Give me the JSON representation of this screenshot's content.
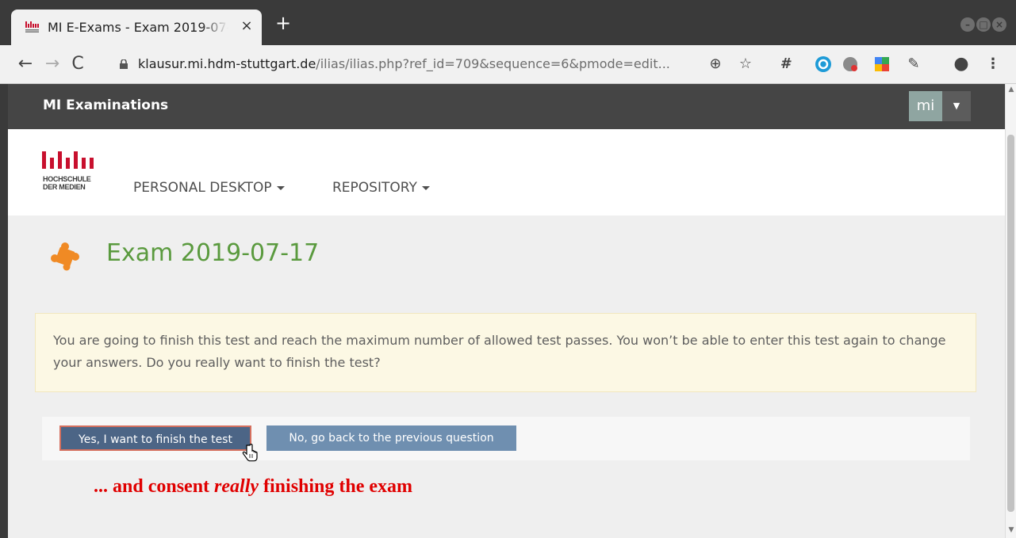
{
  "browser": {
    "tab_title": "MI E-Exams - Exam 2019-07-17",
    "tab_close": "×",
    "new_tab": "+",
    "url_host": "klausur.mi.hdm-stuttgart.de",
    "url_path": "/ilias/ilias.php?ref_id=709&sequence=6&pmode=edit..."
  },
  "header": {
    "brand": "MI Examinations",
    "user": "mi"
  },
  "nav": {
    "logo_line1": "HOCHSCHULE",
    "logo_line2": "DER MEDIEN",
    "personal_desktop": "PERSONAL DESKTOP",
    "repository": "REPOSITORY"
  },
  "main": {
    "title": "Exam 2019-07-17",
    "warning": "You are going to finish this test and reach the maximum number of allowed test passes. You won’t be able to enter this test again to change your answers. Do you really want to finish the test?",
    "confirm_label": "Yes, I want to finish the test",
    "back_label": "No, go back to the previous question"
  },
  "annotation": {
    "prefix": "... and consent ",
    "emphasis": "really",
    "suffix": " finishing the exam"
  },
  "colors": {
    "title_green": "#5a9a3e",
    "brand_red": "#c8102e",
    "annotation_red": "#e00000",
    "confirm_button": "#4c6586",
    "back_button": "#6f8fb0"
  }
}
